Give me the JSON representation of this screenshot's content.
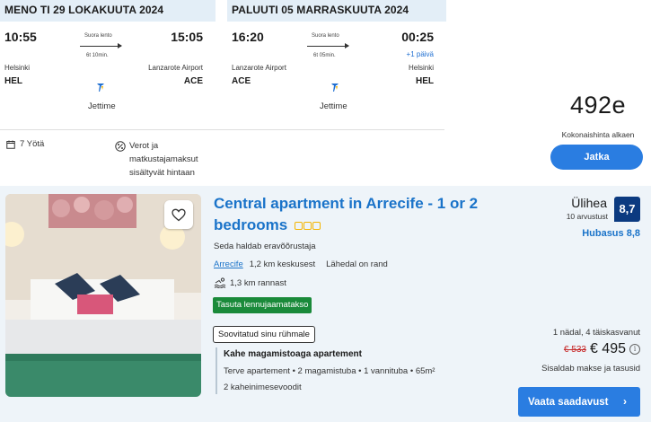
{
  "outbound": {
    "header": "MENO TI 29 LOKAKUUTA 2024",
    "dep_time": "10:55",
    "arr_time": "15:05",
    "direct_label": "Suora lento",
    "duration": "6t 10min.",
    "dep_city": "Helsinki",
    "arr_city": "Lanzarote Airport",
    "dep_code": "HEL",
    "arr_code": "ACE",
    "airline": "Jettime"
  },
  "return": {
    "header": "PALUUTI 05 MARRASKUUTA 2024",
    "dep_time": "16:20",
    "arr_time": "00:25",
    "direct_label": "Suora lento",
    "duration": "6t 05min.",
    "plus_day": "+1 päivä",
    "dep_city": "Lanzarote Airport",
    "arr_city": "Helsinki",
    "dep_code": "ACE",
    "arr_code": "HEL",
    "airline": "Jettime"
  },
  "extras": {
    "nights": "7 Yötä",
    "taxes": "Verot ja matkustajamaksut sisältyvät hintaan"
  },
  "price_box": {
    "price": "492e",
    "from_label": "Kokonaishinta alkaen",
    "continue_label": "Jatka"
  },
  "hotel": {
    "name": "Central apartment in Arrecife - 1 or 2 bedrooms",
    "stars": 3,
    "managed_by": "Seda haldab eravõõrustaja",
    "location_link": "Arrecife",
    "distance_center": "1,2 km keskusest",
    "near_sea": "Lähedal on rand",
    "beach_distance": "1,3 km rannast",
    "free_transfer": "Tasuta lennujaamatakso",
    "suited_badge": "Soovitatud sinu rühmale",
    "room_title": "Kahe magamistoaga apartement",
    "room_desc": "Terve apartement • 2 magamistuba • 1 vannituba • 65m²",
    "beds": "2 kaheinimesevoodit",
    "rating_word": "Ülihea",
    "reviews": "10 arvustust",
    "score": "8,7",
    "cleanliness": "Hubasus 8,8",
    "duration_guests": "1 nädal, 4 täiskasvanut",
    "old_price": "€ 533",
    "new_price": "€ 495",
    "includes": "Sisaldab makse ja tasusid",
    "availability_label": "Vaata saadavust"
  },
  "colors": {
    "accent_blue": "#2a7de1",
    "link_blue": "#1a73c9",
    "score_navy": "#0b3a80",
    "green_badge": "#1a8a3a",
    "header_bg": "#e3eef7",
    "card_bg": "#eef4f9",
    "old_price_red": "#c62828"
  },
  "icons": [
    "calendar-icon",
    "tax-icon",
    "airline-logo-icon",
    "heart-icon",
    "swimmer-icon",
    "info-icon",
    "chevron-right-icon",
    "star-icon"
  ]
}
